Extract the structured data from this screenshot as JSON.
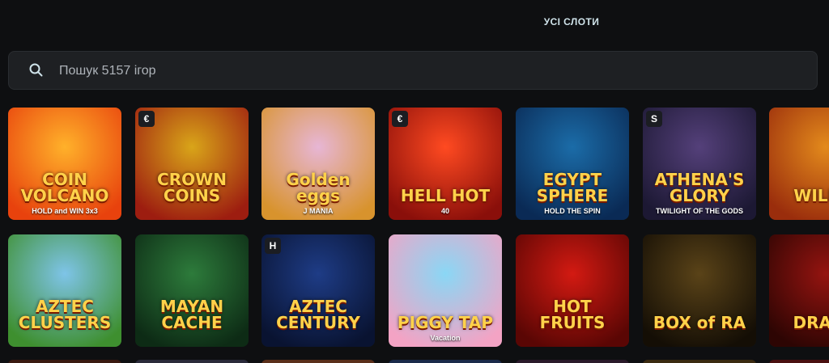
{
  "header": {
    "title": "УСІ СЛОТИ"
  },
  "search": {
    "placeholder": "Пошук 5157 ігор",
    "icon": "search-icon"
  },
  "games": [
    {
      "title": "COIN VOLCANO",
      "subtitle": "HOLD and WIN 3x3",
      "colors": [
        "#ffb12a",
        "#e8420d"
      ]
    },
    {
      "title": "CROWN COINS",
      "subtitle": "",
      "colors": [
        "#d9a519",
        "#9d1d10"
      ],
      "badge": "€"
    },
    {
      "title": "Golden eggs",
      "subtitle": "J MANIA",
      "colors": [
        "#e7b6d5",
        "#d8932d"
      ]
    },
    {
      "title": "HELL HOT",
      "subtitle": "40",
      "colors": [
        "#ff4a21",
        "#8a0f0a"
      ],
      "badge": "€"
    },
    {
      "title": "EGYPT SPHERE",
      "subtitle": "HOLD THE SPIN",
      "colors": [
        "#1b6ca8",
        "#0a2a55"
      ]
    },
    {
      "title": "ATHENA'S GLORY",
      "subtitle": "TWILIGHT OF THE GODS",
      "colors": [
        "#54407a",
        "#1c1833"
      ],
      "badge": "S"
    },
    {
      "title": "WILD T",
      "subtitle": "",
      "colors": [
        "#e38a1c",
        "#9a2d0c"
      ]
    },
    {
      "title": "AZTEC CLUSTERS",
      "subtitle": "",
      "colors": [
        "#7ec4e8",
        "#3e8f2f"
      ]
    },
    {
      "title": "MAYAN CACHE",
      "subtitle": "",
      "colors": [
        "#2d7b3b",
        "#0d2b15"
      ]
    },
    {
      "title": "AZTEC CENTURY",
      "subtitle": "",
      "colors": [
        "#1e3c86",
        "#091331"
      ],
      "badge": "H"
    },
    {
      "title": "PIGGY TAP",
      "subtitle": "Vacation",
      "colors": [
        "#8ad7f5",
        "#f3a3c4"
      ]
    },
    {
      "title": "HOT FRUITS",
      "subtitle": "",
      "colors": [
        "#d31a12",
        "#5a0604"
      ]
    },
    {
      "title": "BOX of RA",
      "subtitle": "",
      "colors": [
        "#5a4318",
        "#140e05"
      ]
    },
    {
      "title": "DRAGO",
      "subtitle": "",
      "colors": [
        "#951410",
        "#2d0503"
      ]
    }
  ]
}
